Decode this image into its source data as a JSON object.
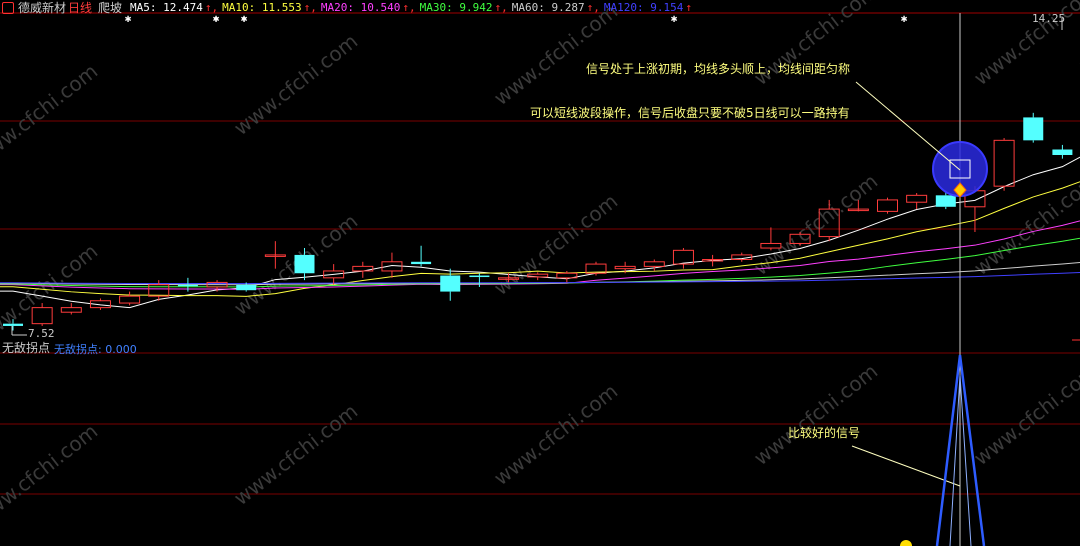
{
  "header": {
    "stock_name": "德威新材",
    "period": "日线",
    "indicator": "爬坡",
    "ma": [
      {
        "label": "MA5: 12.474",
        "arrow": "↑",
        "color": "#ffffff"
      },
      {
        "label": "MA10: 11.553",
        "arrow": "↑",
        "color": "#ffff40"
      },
      {
        "label": "MA20: 10.540",
        "arrow": "↑",
        "color": "#ff40ff"
      },
      {
        "label": "MA30: 9.942",
        "arrow": "↑",
        "color": "#40ff40"
      },
      {
        "label": "MA60: 9.287",
        "arrow": "↑",
        "color": "#cccccc"
      },
      {
        "label": "MA120: 9.154",
        "arrow": "↑",
        "color": "#4040ff"
      }
    ],
    "arrow_color": "#ff3030"
  },
  "price_panel": {
    "high_label": "14.25",
    "low_label": "7.52",
    "annotation_1": "信号处于上涨初期，均线多头顺上，均线间距匀称",
    "annotation_2": "可以短线波段操作，信号后收盘只要不破5日线可以一路持有"
  },
  "indicator_panel": {
    "name": "无敌拐点",
    "value_label": "无敌拐点: 0.000",
    "annotation": "比较好的信号"
  },
  "watermark": "www.cfchi.com",
  "colors": {
    "up": "#ff3c3c",
    "down": "#54ffff",
    "grid": "#7a0000",
    "signal": "#2e5cff",
    "annotation": "#ffff80"
  },
  "chart_data": {
    "type": "candlestick",
    "candles": [
      [
        7.6,
        7.7,
        7.45,
        7.55
      ],
      [
        7.6,
        8.05,
        7.55,
        7.95
      ],
      [
        7.85,
        8.05,
        7.8,
        7.95
      ],
      [
        7.95,
        8.15,
        7.9,
        8.1
      ],
      [
        8.05,
        8.3,
        8.0,
        8.2
      ],
      [
        8.2,
        8.55,
        8.1,
        8.45
      ],
      [
        8.45,
        8.6,
        8.3,
        8.43
      ],
      [
        8.4,
        8.55,
        8.3,
        8.5
      ],
      [
        8.45,
        8.5,
        8.3,
        8.33
      ],
      [
        9.1,
        9.4,
        8.8,
        9.1
      ],
      [
        9.1,
        9.25,
        8.55,
        8.7
      ],
      [
        8.6,
        8.9,
        8.45,
        8.75
      ],
      [
        8.75,
        8.95,
        8.6,
        8.85
      ],
      [
        8.75,
        9.15,
        8.6,
        8.95
      ],
      [
        8.95,
        9.3,
        8.85,
        8.9
      ],
      [
        8.65,
        8.8,
        8.1,
        8.3
      ],
      [
        8.65,
        8.7,
        8.4,
        8.62
      ],
      [
        8.6,
        8.7,
        8.5,
        8.6
      ],
      [
        8.62,
        8.72,
        8.55,
        8.68
      ],
      [
        8.6,
        8.75,
        8.5,
        8.7
      ],
      [
        8.7,
        8.95,
        8.65,
        8.9
      ],
      [
        8.8,
        8.95,
        8.7,
        8.85
      ],
      [
        8.85,
        9.0,
        8.75,
        8.95
      ],
      [
        8.9,
        9.25,
        8.8,
        9.2
      ],
      [
        9.0,
        9.1,
        8.85,
        9.0
      ],
      [
        9.0,
        9.15,
        8.95,
        9.1
      ],
      [
        9.25,
        9.7,
        9.2,
        9.35
      ],
      [
        9.35,
        9.6,
        9.3,
        9.55
      ],
      [
        9.5,
        10.3,
        9.4,
        10.1
      ],
      [
        10.1,
        10.3,
        10.05,
        10.1
      ],
      [
        10.05,
        10.35,
        10.0,
        10.3
      ],
      [
        10.25,
        10.45,
        10.1,
        10.4
      ],
      [
        10.4,
        10.5,
        10.1,
        10.15
      ],
      [
        10.15,
        10.6,
        9.6,
        10.5
      ],
      [
        10.6,
        11.65,
        10.5,
        11.6
      ],
      [
        12.1,
        12.2,
        11.55,
        11.6
      ],
      [
        11.4,
        11.5,
        11.2,
        11.28
      ],
      [
        11.3,
        11.95,
        11.25,
        11.85
      ],
      [
        11.6,
        12.4,
        11.5,
        12.1
      ],
      [
        12.05,
        12.4,
        11.9,
        12.2
      ],
      [
        12.2,
        13.3,
        11.9,
        12.9
      ],
      [
        12.9,
        13.2,
        12.7,
        13.25
      ],
      [
        13.25,
        14.25,
        13.2,
        13.95
      ]
    ]
  }
}
